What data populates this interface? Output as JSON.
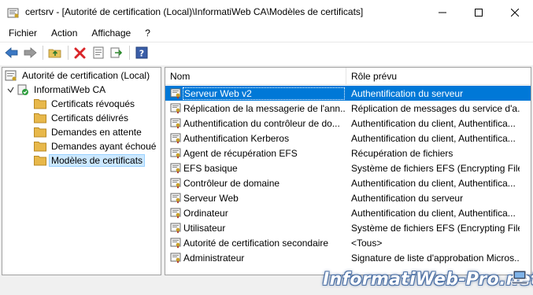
{
  "window": {
    "title": "certsrv - [Autorité de certification (Local)\\InformatiWeb CA\\Modèles de certificats]"
  },
  "menu": [
    "Fichier",
    "Action",
    "Affichage",
    "?"
  ],
  "toolbar": {
    "buttons": [
      "back-icon",
      "forward-icon",
      "up-folder-icon",
      "delete-icon",
      "properties-icon",
      "export-icon",
      "help-icon"
    ]
  },
  "tree": {
    "root": "Autorité de certification (Local)",
    "ca": "InformatiWeb CA",
    "folders": [
      "Certificats révoqués",
      "Certificats délivrés",
      "Demandes en attente",
      "Demandes ayant échoué",
      "Modèles de certificats"
    ],
    "selected_index": 4
  },
  "list": {
    "columns": [
      "Nom",
      "Rôle prévu"
    ],
    "selected_index": 0,
    "rows": [
      {
        "name": "Serveur Web v2",
        "role": "Authentification du serveur"
      },
      {
        "name": "Réplication de la messagerie de l'ann...",
        "role": "Réplication de messages du service d'a..."
      },
      {
        "name": "Authentification du contrôleur de do...",
        "role": "Authentification du client, Authentifica..."
      },
      {
        "name": "Authentification Kerberos",
        "role": "Authentification du client, Authentifica..."
      },
      {
        "name": "Agent de récupération EFS",
        "role": "Récupération de fichiers"
      },
      {
        "name": "EFS basique",
        "role": "Système de fichiers EFS (Encrypting File..."
      },
      {
        "name": "Contrôleur de domaine",
        "role": "Authentification du client, Authentifica..."
      },
      {
        "name": "Serveur Web",
        "role": "Authentification du serveur"
      },
      {
        "name": "Ordinateur",
        "role": "Authentification du client, Authentifica..."
      },
      {
        "name": "Utilisateur",
        "role": "Système de fichiers EFS (Encrypting File..."
      },
      {
        "name": "Autorité de certification secondaire",
        "role": "<Tous>"
      },
      {
        "name": "Administrateur",
        "role": "Signature de liste d'approbation Micros..."
      }
    ]
  },
  "watermark": "InformatiWeb-Pro.net",
  "colors": {
    "selection": "#0078d7",
    "tree_selection": "#cce8ff",
    "folder": "#e8b84a"
  }
}
